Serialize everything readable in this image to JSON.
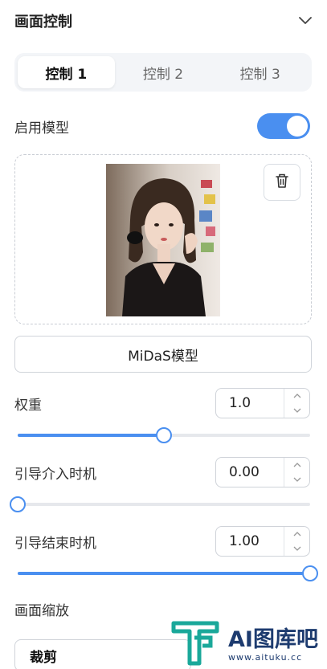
{
  "panel": {
    "title": "画面控制",
    "chevron_icon": "chevron-down-icon"
  },
  "tabs": [
    {
      "label": "控制 1",
      "active": true
    },
    {
      "label": "控制 2",
      "active": false
    },
    {
      "label": "控制 3",
      "active": false
    }
  ],
  "enable_model": {
    "label": "启用模型",
    "enabled": true
  },
  "upload": {
    "delete_icon": "trash-icon"
  },
  "model": {
    "label": "MiDaS模型"
  },
  "weight": {
    "label": "权重",
    "value": "1.0",
    "slider_fraction": 0.5
  },
  "guidance_start": {
    "label": "引导介入时机",
    "value": "0.00",
    "slider_fraction": 0.0
  },
  "guidance_end": {
    "label": "引导结束时机",
    "value": "1.00",
    "slider_fraction": 1.0
  },
  "resize": {
    "label": "画面缩放",
    "selected": "裁剪"
  },
  "watermark": {
    "text": "AI图库吧",
    "url": "www.aituku.cc"
  },
  "colors": {
    "accent": "#4a8ff0",
    "track": "#e6e8ec"
  }
}
